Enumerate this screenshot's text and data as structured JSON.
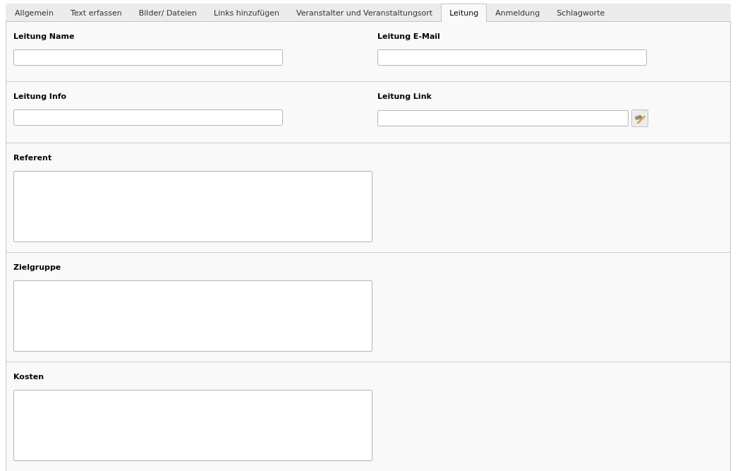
{
  "tabs": [
    {
      "label": "Allgemein",
      "selected": false
    },
    {
      "label": "Text erfassen",
      "selected": false
    },
    {
      "label": "Bilder/ Dateien",
      "selected": false
    },
    {
      "label": "Links hinzufügen",
      "selected": false
    },
    {
      "label": "Veranstalter und Veranstaltungsort",
      "selected": false
    },
    {
      "label": "Leitung",
      "selected": true
    },
    {
      "label": "Anmeldung",
      "selected": false
    },
    {
      "label": "Schlagworte",
      "selected": false
    }
  ],
  "sections": [
    {
      "fields": [
        {
          "label": "Leitung Name",
          "kind": "input"
        },
        {
          "label": "Leitung E-Mail",
          "kind": "input"
        }
      ]
    },
    {
      "fields": [
        {
          "label": "Leitung Info",
          "kind": "input"
        },
        {
          "label": "Leitung Link",
          "kind": "link"
        }
      ]
    },
    {
      "fields": [
        {
          "label": "Referent",
          "kind": "textarea"
        }
      ]
    },
    {
      "fields": [
        {
          "label": "Zielgruppe",
          "kind": "textarea"
        }
      ]
    },
    {
      "fields": [
        {
          "label": "Kosten",
          "kind": "textarea"
        }
      ]
    }
  ]
}
